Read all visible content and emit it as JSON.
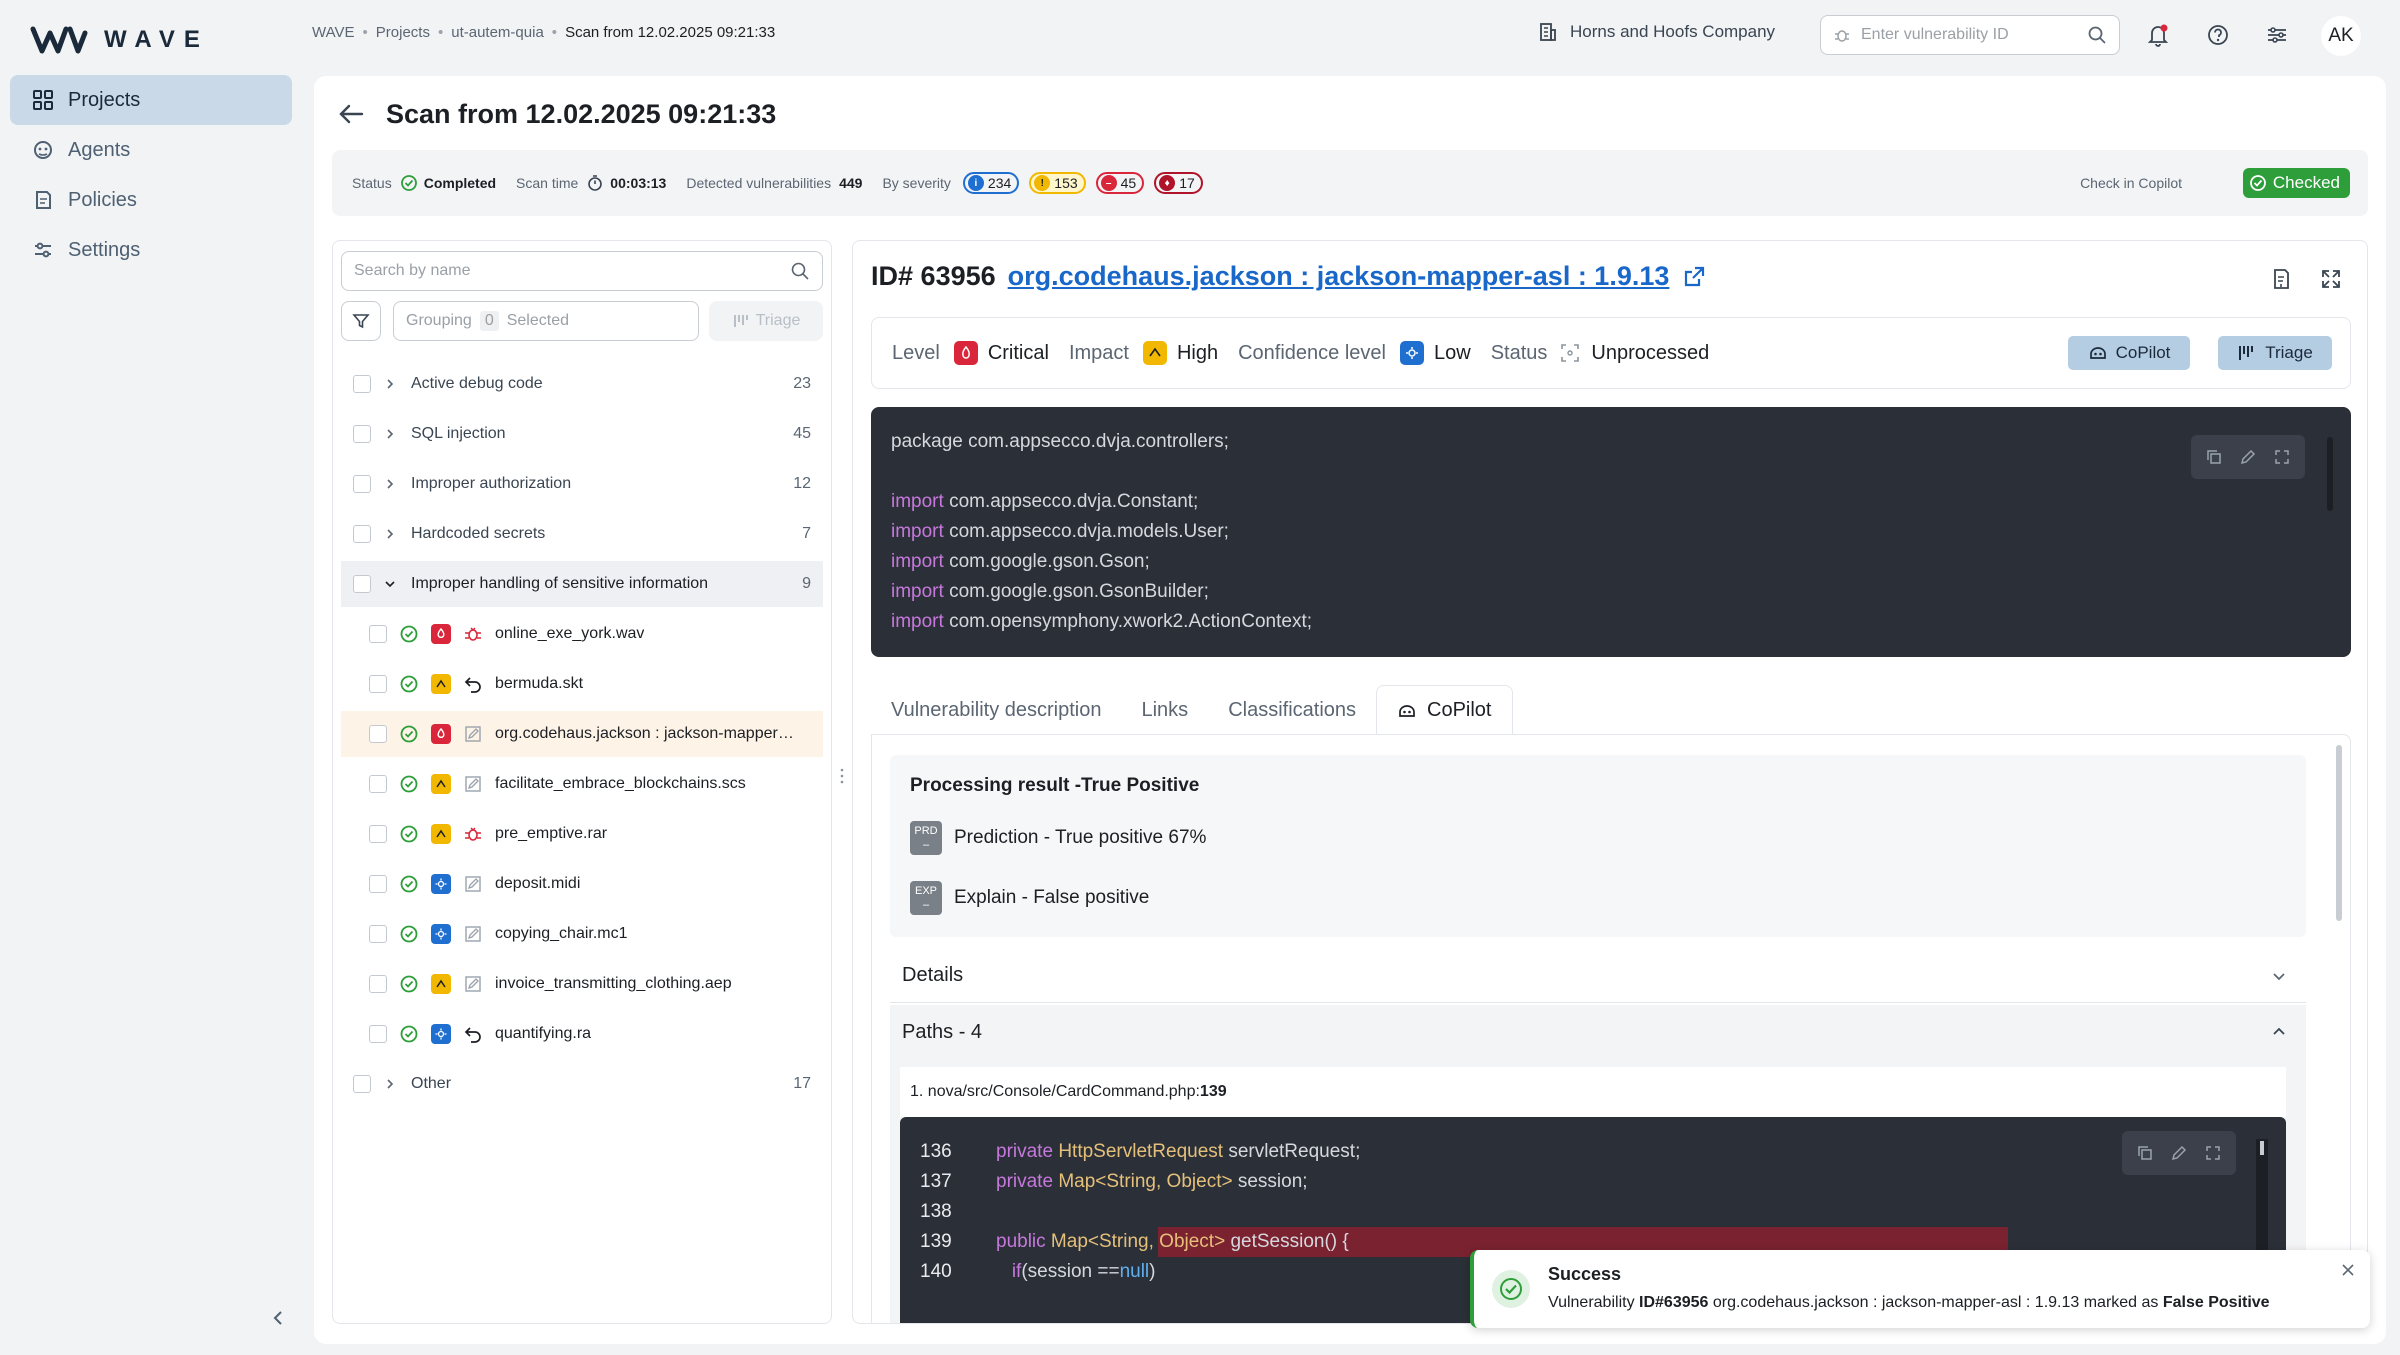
{
  "app": {
    "logo_text": "WAVE"
  },
  "sidebar": {
    "items": [
      {
        "label": "Projects",
        "icon": "grid-icon",
        "active": true
      },
      {
        "label": "Agents",
        "icon": "agent-icon",
        "active": false
      },
      {
        "label": "Policies",
        "icon": "policy-icon",
        "active": false
      },
      {
        "label": "Settings",
        "icon": "sliders-icon",
        "active": false
      }
    ]
  },
  "header": {
    "breadcrumb": [
      "WAVE",
      "Projects",
      "ut-autem-quia",
      "Scan from 12.02.2025 09:21:33"
    ],
    "company": "Horns and Hoofs Company",
    "search_placeholder": "Enter vulnerability ID",
    "avatar": "AK"
  },
  "page": {
    "title": "Scan from 12.02.2025 09:21:33"
  },
  "status_bar": {
    "status_label": "Status",
    "status_value": "Completed",
    "scan_time_label": "Scan time",
    "scan_time_value": "00:03:13",
    "detected_label": "Detected vulnerabilities",
    "detected_value": "449",
    "severity_label": "By severity",
    "severity": [
      {
        "name": "low",
        "count": "234",
        "color": "#1f6fd1"
      },
      {
        "name": "high",
        "count": "153",
        "color": "#f2b800"
      },
      {
        "name": "critical",
        "count": "45",
        "color": "#d9263a"
      },
      {
        "name": "blocker",
        "count": "17",
        "color": "#b0142a"
      }
    ],
    "copilot_label": "Check in Copilot",
    "copilot_value": "Checked"
  },
  "left_panel": {
    "search_placeholder": "Search by name",
    "grouping_label": "Grouping",
    "grouping_count": "0",
    "grouping_selected": "Selected",
    "triage_label": "Triage",
    "groups_top": [
      {
        "label": "Active debug code",
        "count": "23"
      },
      {
        "label": "SQL injection",
        "count": "45"
      },
      {
        "label": "Improper authorization",
        "count": "12"
      },
      {
        "label": "Hardcoded secrets",
        "count": "7"
      },
      {
        "label": "Improper handling of sensitive information",
        "count": "9"
      }
    ],
    "leaves": [
      {
        "name": "online_exe_york.wav",
        "severity": "critical",
        "type": "bug-icon"
      },
      {
        "name": "bermuda.skt",
        "severity": "high",
        "type": "undo-icon"
      },
      {
        "name": "org.codehaus.jackson : jackson-mapper-asl : 1.9.13",
        "severity": "critical",
        "type": "edit-icon"
      },
      {
        "name": "facilitate_embrace_blockchains.scs",
        "severity": "high",
        "type": "edit-icon"
      },
      {
        "name": "pre_emptive.rar",
        "severity": "high",
        "type": "bug-icon"
      },
      {
        "name": "deposit.midi",
        "severity": "low",
        "type": "edit-icon"
      },
      {
        "name": "copying_chair.mc1",
        "severity": "low",
        "type": "edit-icon"
      },
      {
        "name": "invoice_transmitting_clothing.aep",
        "severity": "high",
        "type": "edit-icon"
      },
      {
        "name": "quantifying.ra",
        "severity": "low",
        "type": "undo-icon"
      }
    ],
    "group_other": {
      "label": "Other",
      "count": "17"
    }
  },
  "detail": {
    "id_label": "ID#",
    "id_value": "63956",
    "link_text": "org.codehaus.jackson : jackson-mapper-asl : 1.9.13",
    "level_label": "Level",
    "level_value": "Critical",
    "impact_label": "Impact",
    "impact_value": "High",
    "confidence_label": "Confidence level",
    "confidence_value": "Low",
    "status_label": "Status",
    "status_value": "Unprocessed",
    "copilot_button": "CoPilot",
    "triage_button": "Triage",
    "code": {
      "package_line": "package com.appsecco.dvja.controllers;",
      "import_kw": "import",
      "imports": [
        "com.appsecco.dvja.Constant;",
        "com.appsecco.dvja.models.User;",
        "com.google.gson.Gson;",
        "com.google.gson.GsonBuilder;",
        "com.opensymphony.xwork2.ActionContext;"
      ]
    },
    "tabs": [
      "Vulnerability description",
      "Links",
      "Classifications",
      "CoPilot"
    ],
    "copilot": {
      "result_title": "Processing result -True Positive",
      "prediction_badge": "PRD",
      "prediction": "Prediction - True positive 67%",
      "explain_badge": "EXP",
      "explain": "Explain - False positive",
      "details_label": "Details",
      "paths_label": "Paths - 4",
      "path_prefix": "1. nova/src/Console/CardCommand.php: ",
      "path_line": "139"
    },
    "code2": [
      {
        "n": "136",
        "a": "private ",
        "t": "HttpServletRequest",
        "b": " servletRequest;"
      },
      {
        "n": "137",
        "a": "private ",
        "t": "Map<String, Object>",
        "b": " session;"
      },
      {
        "n": "138",
        "a": "",
        "t": "",
        "b": ""
      },
      {
        "n": "139",
        "a": "public ",
        "t": "Map<String, Object>",
        "b": " getSession() {"
      },
      {
        "n": "140",
        "a": "   if",
        "t": "",
        "b": "(session == null)"
      }
    ],
    "code2_null": "null"
  },
  "toast": {
    "title": "Success",
    "msg_prefix": "Vulnerability ",
    "msg_id": "ID#63956",
    "msg_middle": " org.codehaus.jackson : jackson-mapper-asl : 1.9.13 marked as ",
    "msg_status": "False Positive"
  }
}
